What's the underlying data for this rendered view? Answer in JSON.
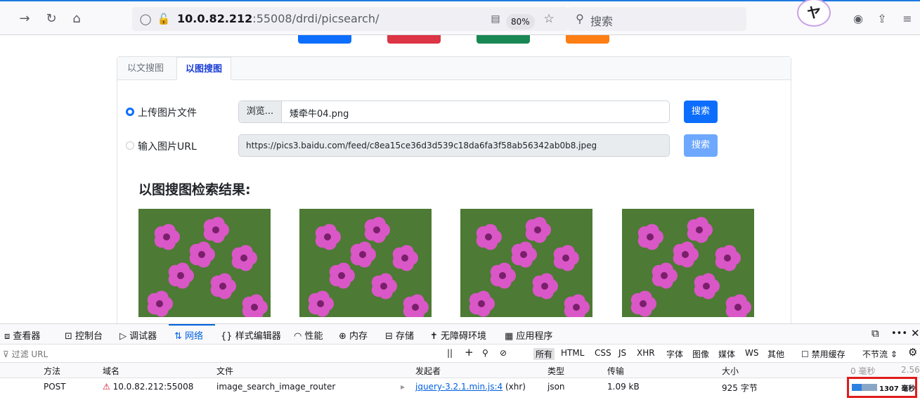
{
  "browser": {
    "url_host": "10.0.82.212",
    "url_rest": ":55008/drdi/picsearch/",
    "zoom": "80%",
    "search_placeholder": "搜索"
  },
  "colors": {
    "accent": "#0d6efd",
    "top_buttons": [
      "#0d6efd",
      "#dc3545",
      "#198754",
      "#fd7e14"
    ]
  },
  "page": {
    "tabs": [
      {
        "label": "以文搜图",
        "active": false
      },
      {
        "label": "以图搜图",
        "active": true
      }
    ],
    "upload_option_label": "上传图片文件",
    "browse_label": "浏览...",
    "file_name": "矮牵牛04.png",
    "url_option_label": "输入图片URL",
    "url_value": "https://pics3.baidu.com/feed/c8ea15ce36d3d539c18da6fa3f58ab56342ab0b8.jpeg",
    "search_button": "搜索",
    "results_title": "以图搜图检索结果:"
  },
  "devtools": {
    "tabs": [
      "查看器",
      "控制台",
      "调试器",
      "网络",
      "样式编辑器",
      "性能",
      "内存",
      "存储",
      "无障碍环境",
      "应用程序"
    ],
    "filter_placeholder": "过滤 URL",
    "types": [
      "所有",
      "HTML",
      "CSS",
      "JS",
      "XHR",
      "字体",
      "图像",
      "媒体",
      "WS",
      "其他"
    ],
    "disable_cache": "禁用缓存",
    "throttle": "不节流",
    "columns": [
      "方法",
      "域名",
      "文件",
      "发起者",
      "类型",
      "传输",
      "大小",
      "0 毫秒",
      "2.56"
    ],
    "request": {
      "method": "POST",
      "domain": "10.0.82.212:55008",
      "file": "image_search_image_router",
      "initiator_link": "jquery-3.2.1.min.js:4",
      "initiator_suffix": "(xhr)",
      "type": "json",
      "transferred": "1.09 kB",
      "size": "925 字节",
      "timing": "1307 毫秒"
    }
  }
}
